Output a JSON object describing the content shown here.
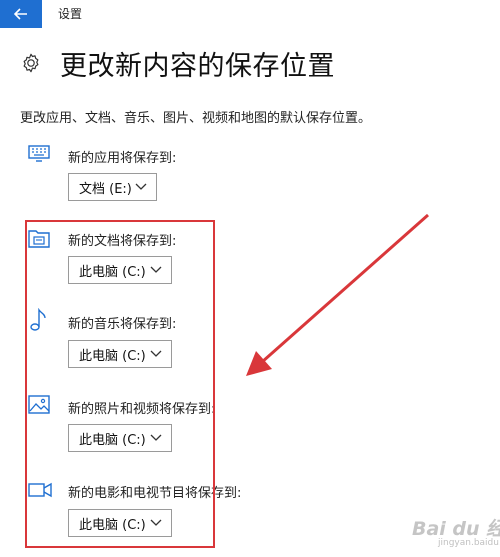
{
  "app": {
    "title": "设置"
  },
  "header": {
    "title": "更改新内容的保存位置"
  },
  "description": "更改应用、文档、音乐、图片、视频和地图的默认保存位置。",
  "items": [
    {
      "label": "新的应用将保存到:",
      "value": "文档 (E:)",
      "icon": "monitor-icon"
    },
    {
      "label": "新的文档将保存到:",
      "value": "此电脑 (C:)",
      "icon": "document-folder-icon"
    },
    {
      "label": "新的音乐将保存到:",
      "value": "此电脑 (C:)",
      "icon": "music-note-icon"
    },
    {
      "label": "新的照片和视频将保存到:",
      "value": "此电脑 (C:)",
      "icon": "picture-icon"
    },
    {
      "label": "新的电影和电视节目将保存到:",
      "value": "此电脑 (C:)",
      "icon": "video-camera-icon"
    }
  ],
  "watermark": {
    "brand": "Bai du 经验",
    "sub": "jingyan.baidu.com"
  },
  "colors": {
    "accent": "#1f6fd1",
    "highlight": "#d9373a",
    "icon": "#1f6fd1"
  }
}
